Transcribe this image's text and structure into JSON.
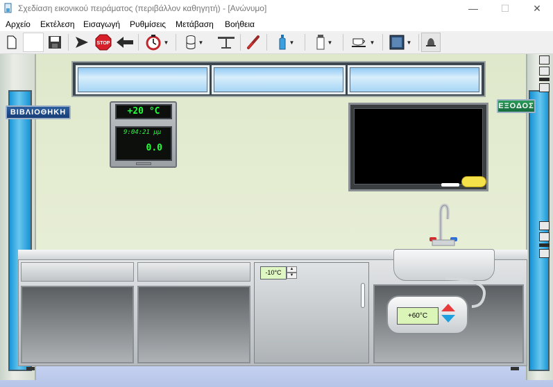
{
  "window": {
    "title": "Σχεδίαση εικονικού πειράματος (περιβάλλον καθηγητή) - [Ανώνυμο]",
    "min_glyph": "—",
    "max_glyph": "☐",
    "close_glyph": "✕"
  },
  "menu": {
    "items": [
      "Αρχείο",
      "Εκτέλεση",
      "Εισαγωγή",
      "Ρυθμίσεις",
      "Μετάβαση",
      "Βοήθεια"
    ]
  },
  "toolbar": {
    "stop_label": "STOP",
    "icons": [
      "new-document-icon",
      "open-icon",
      "save-icon",
      "run-icon",
      "stop-icon",
      "back-arrow-icon",
      "timer-icon",
      "beaker-icon",
      "balance-icon",
      "thermometer-icon",
      "bottle-icon",
      "flask-icon",
      "cup-icon",
      "image-icon",
      "bell-icon"
    ]
  },
  "scene": {
    "library_sign": "ΒΙΒΛΙΟΘΗΚΗ",
    "exit_sign": "ΕΞΟΔΟΣ",
    "room_temperature": "+20 °C",
    "clock_time": "9:04:21 μμ",
    "clock_value": "0.0",
    "fridge_setpoint": "-10°C",
    "heater_temperature": "+60°C"
  },
  "colors": {
    "lcd_green": "#26ff3a",
    "door_blue": "#1a98d8",
    "wall": "#e3ecd0",
    "heater_up": "#e83b3b",
    "heater_down": "#1e9fe0"
  }
}
